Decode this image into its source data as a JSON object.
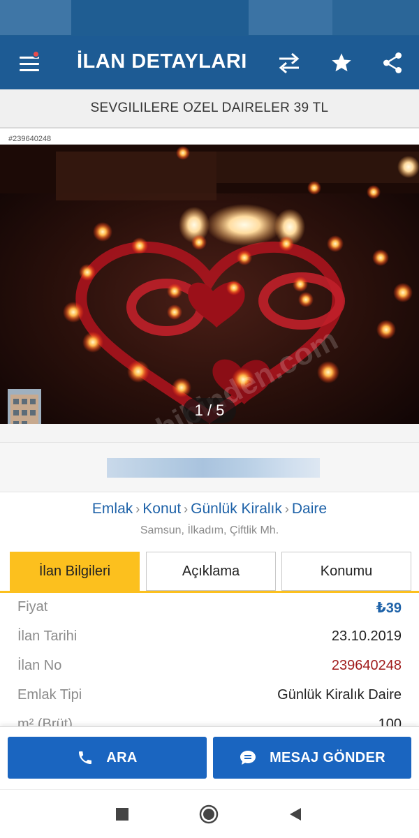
{
  "app_bar": {
    "title": "İLAN DETAYLARI",
    "icons": [
      "menu-icon",
      "compare-arrows-icon",
      "star-icon",
      "share-icon"
    ],
    "notification_dot_color": "#e94b4b",
    "background": "#1d5b94"
  },
  "listing": {
    "title": "SEVGILILERE OZEL DAIRELER 39 TL",
    "id_tag": "#239640248",
    "photo_counter": "1 / 5"
  },
  "breadcrumb": {
    "items": [
      "Emlak",
      "Konut",
      "Günlük Kiralık",
      "Daire"
    ],
    "separator": "›",
    "location": "Samsun, İlkadım, Çiftlik Mh."
  },
  "tabs": {
    "items": [
      "İlan Bilgileri",
      "Açıklama",
      "Konumu"
    ],
    "active": "İlan Bilgileri",
    "active_color": "#fcc01e"
  },
  "info": {
    "rows": [
      {
        "label": "Fiyat",
        "value": "₺39"
      },
      {
        "label": "İlan Tarihi",
        "value": "23.10.2019"
      },
      {
        "label": "İlan No",
        "value": "239640248"
      },
      {
        "label": "Emlak Tipi",
        "value": "Günlük Kiralık Daire"
      },
      {
        "label": "m² (Brüt)",
        "value": "100"
      }
    ]
  },
  "actions": {
    "call_label": "ARA",
    "message_label": "MESAJ GÖNDER",
    "button_color": "#1a65c0"
  }
}
